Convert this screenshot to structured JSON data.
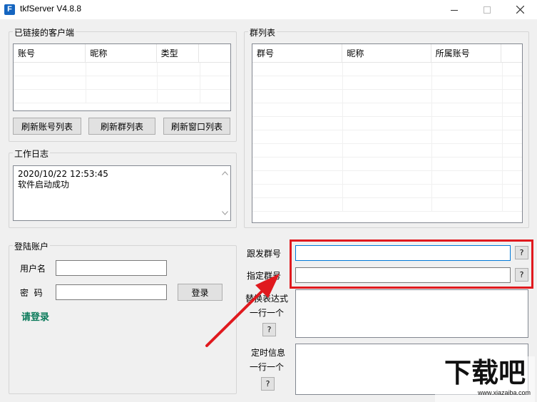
{
  "window": {
    "title": "tkfServer  V4.8.8",
    "app_icon_letter": "F"
  },
  "clients_group": {
    "title": "已链接的客户端",
    "columns": [
      "账号",
      "昵称",
      "类型"
    ]
  },
  "group_list": {
    "title": "群列表",
    "columns": [
      "群号",
      "昵称",
      "所属账号"
    ]
  },
  "buttons": {
    "refresh_accounts": "刷新账号列表",
    "refresh_groups": "刷新群列表",
    "refresh_windows": "刷新窗口列表",
    "login": "登录",
    "help": "?"
  },
  "log": {
    "title": "工作日志",
    "lines": [
      "2020/10/22 12:53:45",
      "软件启动成功"
    ]
  },
  "login": {
    "title": "登陆账户",
    "username_label": "用户名",
    "password_label": "密  码",
    "username_value": "",
    "password_value": "",
    "status": "请登录"
  },
  "settings": {
    "follow_group_label": "跟发群号",
    "target_group_label": "指定群号",
    "replace_expr_label": "替换表达式",
    "replace_expr_sub": "一行一个",
    "timed_msg_label": "定时信息",
    "timed_msg_sub": "一行一个",
    "follow_group_value": "",
    "target_group_value": "",
    "replace_expr_value": "",
    "timed_msg_value": ""
  },
  "watermark": {
    "logo_text": "下载吧",
    "url": "www.xiazaiba.com"
  },
  "colors": {
    "highlight": "#e0191e",
    "status_green": "#0a7a5a",
    "app_icon": "#1565c0"
  }
}
